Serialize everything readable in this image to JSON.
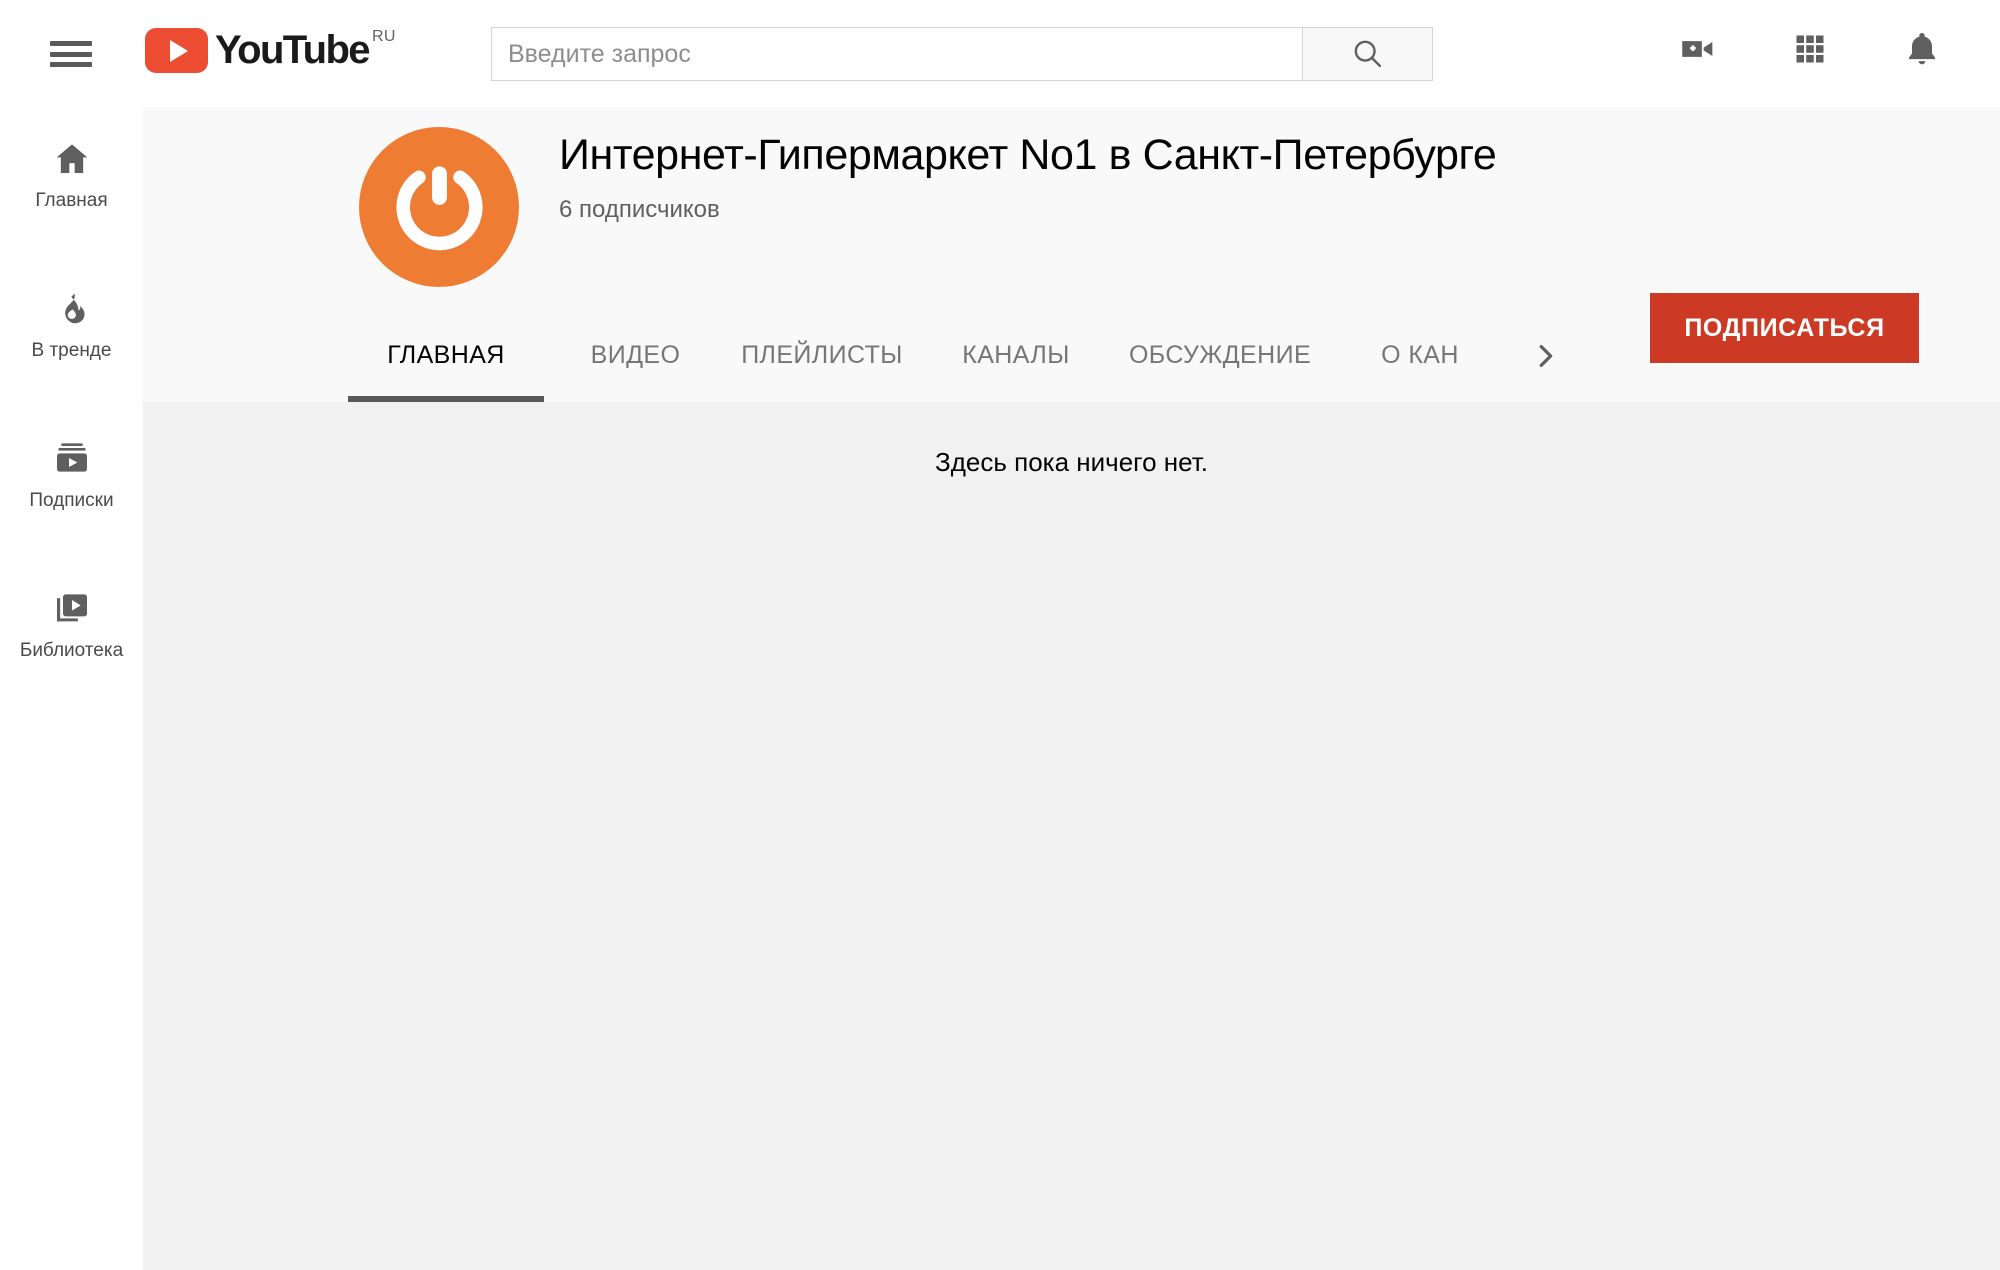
{
  "brand": {
    "logo_text": "YouTube",
    "logo_superscript": "RU",
    "logo_red": "#ec4c32"
  },
  "topbar": {
    "menu_label": "Меню",
    "search": {
      "placeholder": "Введите запрос",
      "value": "",
      "button_label": "Поиск"
    },
    "icons": [
      {
        "name": "create-video-icon",
        "label": "Добавить видео"
      },
      {
        "name": "apps-grid-icon",
        "label": "Приложения YouTube"
      },
      {
        "name": "notifications-bell-icon",
        "label": "Уведомления"
      }
    ]
  },
  "sidebar": {
    "items": [
      {
        "label": "Главная",
        "icon": "home-icon"
      },
      {
        "label": "В тренде",
        "icon": "trending-flame-icon"
      },
      {
        "label": "Подписки",
        "icon": "subscriptions-icon"
      },
      {
        "label": "Библиотека",
        "icon": "library-icon"
      }
    ]
  },
  "channel": {
    "title": "Интернет-Гипермаркет No1 в Санкт-Петербурге",
    "subscribers": "6 подписчиков",
    "avatar_icon": "power-button-icon",
    "avatar_color": "#ee7d33",
    "subscribe_label": "ПОДПИСАТЬСЯ",
    "subscribe_color": "#cc3a26",
    "tabs": [
      {
        "label": "ГЛАВНАЯ",
        "active": true
      },
      {
        "label": "ВИДЕО",
        "active": false
      },
      {
        "label": "ПЛЕЙЛИСТЫ",
        "active": false
      },
      {
        "label": "КАНАЛЫ",
        "active": false
      },
      {
        "label": "ОБСУЖДЕНИЕ",
        "active": false
      },
      {
        "label": "О КАН",
        "active": false
      }
    ],
    "tabs_more_icon": "chevron-right-icon"
  },
  "main": {
    "empty_message": "Здесь пока ничего нет."
  }
}
